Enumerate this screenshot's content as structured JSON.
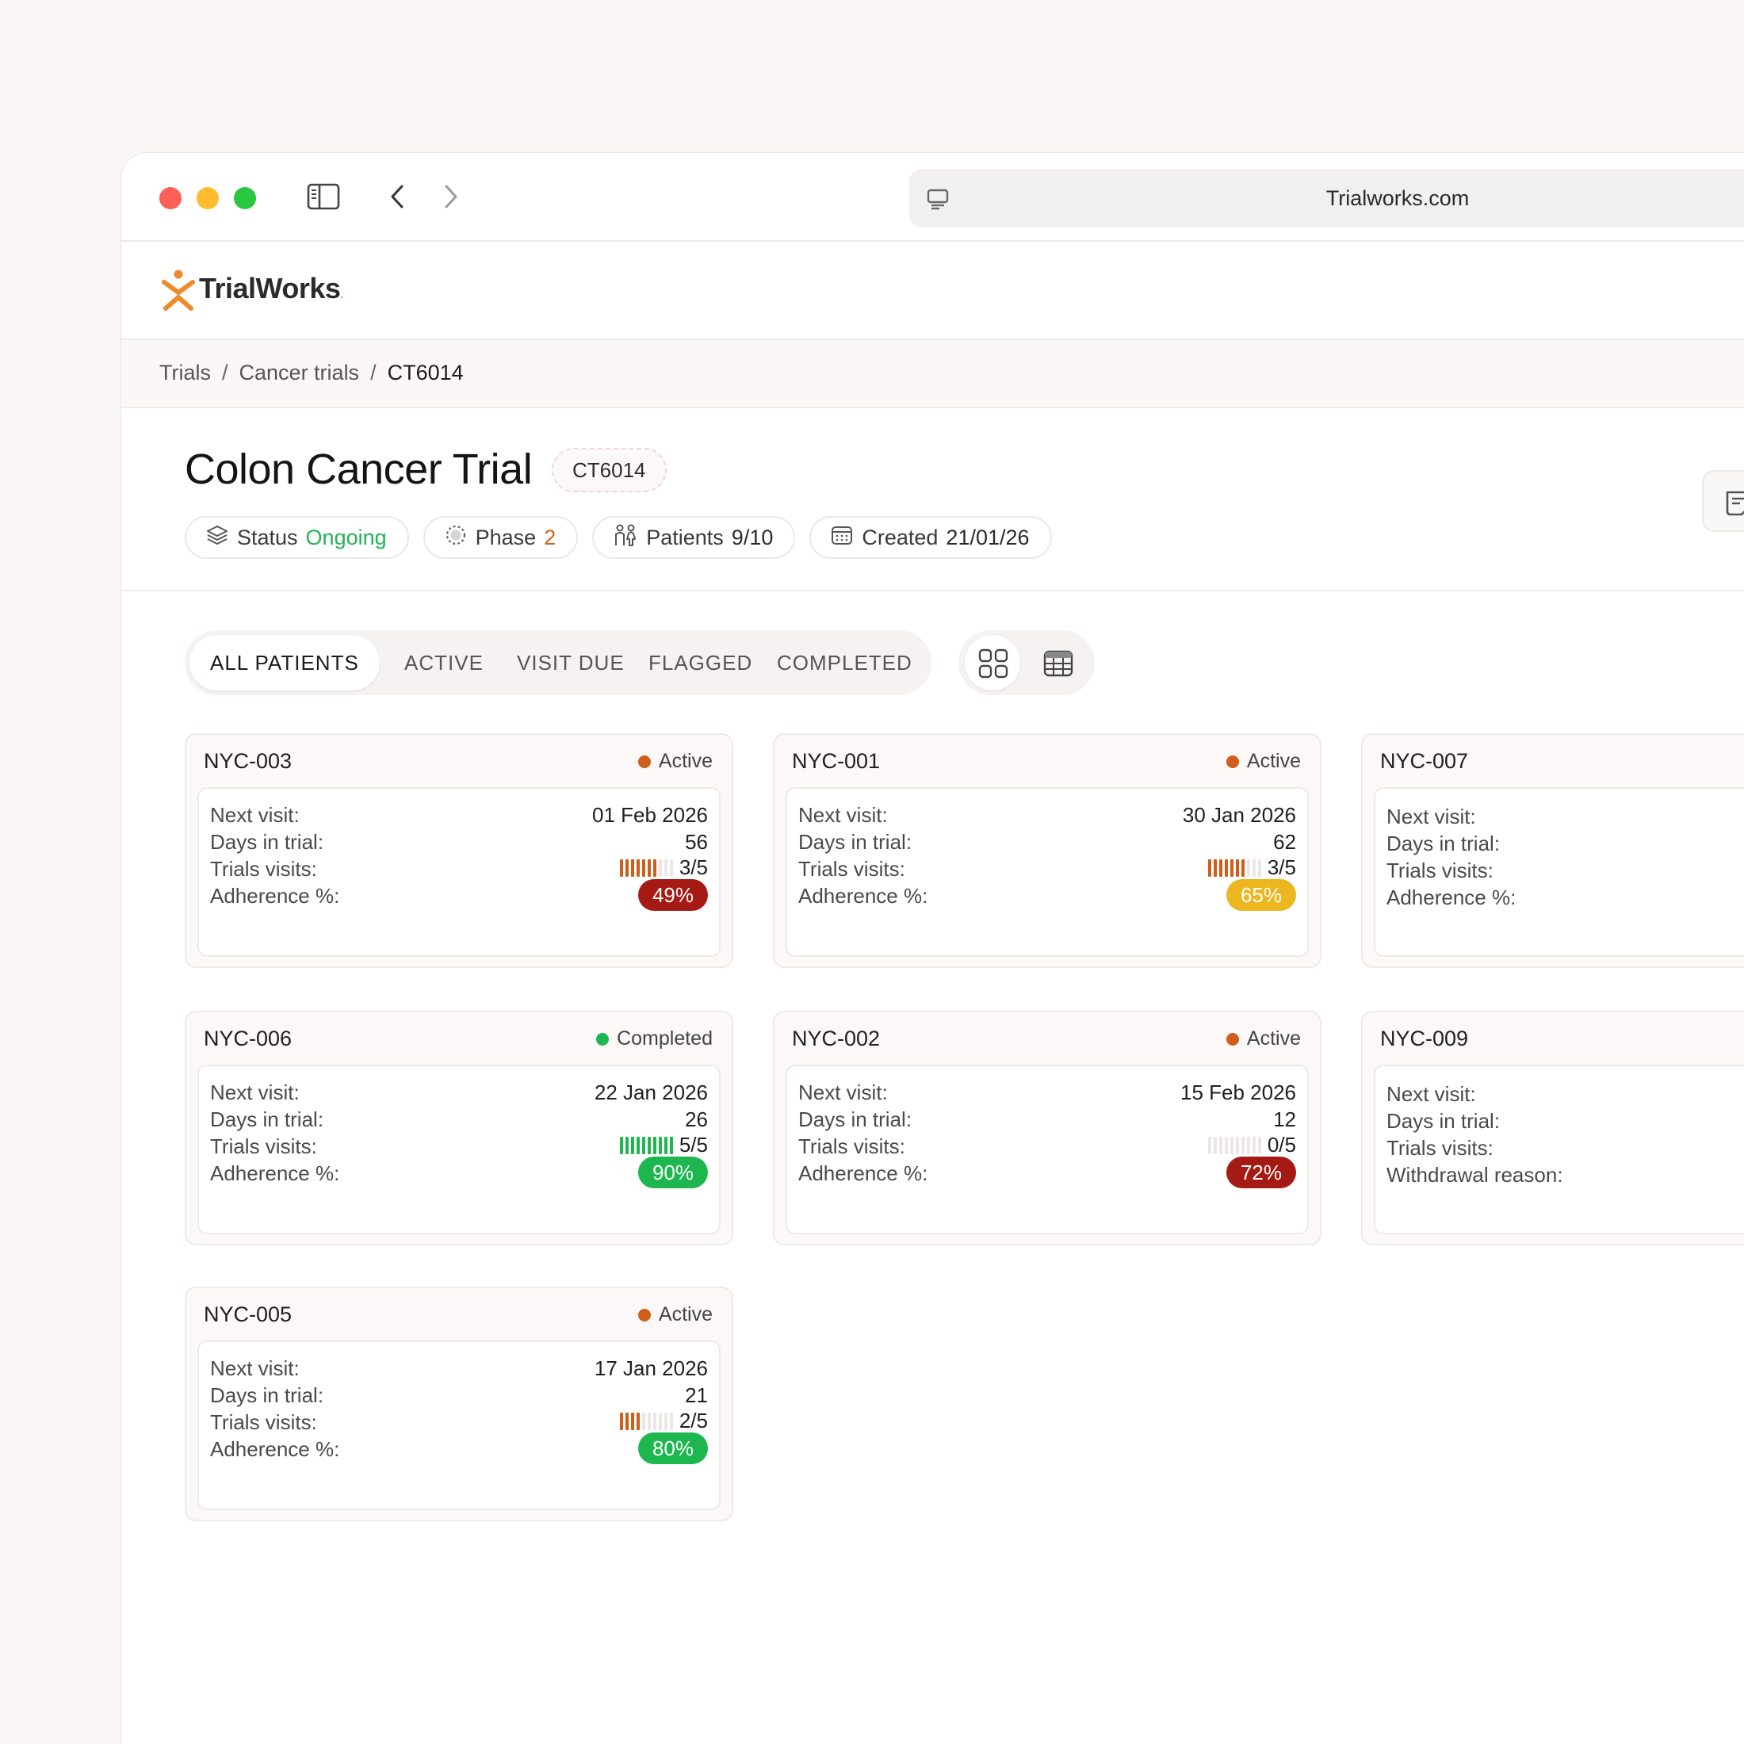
{
  "browser": {
    "url": "Trialworks.com"
  },
  "app": {
    "logo_text": "TrialWorks",
    "logo_mark_color": "#ee8a2c"
  },
  "breadcrumb": [
    "Trials",
    "Cancer trials",
    "CT6014"
  ],
  "trial": {
    "title": "Colon Cancer Trial",
    "code": "CT6014",
    "chips": [
      {
        "label": "Status",
        "value": "Ongoing",
        "icon": "layers-icon"
      },
      {
        "label": "Phase",
        "value": "2",
        "icon": "dashed-circle-icon"
      },
      {
        "label": "Patients",
        "value": "9/10",
        "icon": "people-icon"
      },
      {
        "label": "Created",
        "value": "21/01/26",
        "icon": "calendar-icon"
      }
    ]
  },
  "tabs": [
    "ALL PATIENTS",
    "ACTIVE",
    "VISIT DUE",
    "FLAGGED",
    "COMPLETED"
  ],
  "active_tab": "ALL PATIENTS",
  "view_toggle": {
    "grid_icon": "grid-icon",
    "table_icon": "table-icon",
    "selected": "grid"
  },
  "colors": {
    "active": "#cf5e1b",
    "completed": "#1eb74f",
    "adherence_red": "#a51a14",
    "adherence_yellow": "#ecb71e",
    "adherence_green": "#1eb74f"
  },
  "labels": {
    "next_visit": "Next visit:",
    "days_in_trial": "Days in trial:",
    "trial_visits": "Trials visits:",
    "adherence": "Adherence %:",
    "withdrawal": "Withdrawal reason:"
  },
  "patients": [
    {
      "id": "NYC-003",
      "status": "Active",
      "next_visit": "01 Feb 2026",
      "days": "56",
      "visits_done": 3,
      "visits_total": 5,
      "visits": "3/5",
      "adherence": "49%",
      "adherence_level": "red"
    },
    {
      "id": "NYC-001",
      "status": "Active",
      "next_visit": "30 Jan 2026",
      "days": "62",
      "visits_done": 3,
      "visits_total": 5,
      "visits": "3/5",
      "adherence": "65%",
      "adherence_level": "yellow"
    },
    {
      "id": "NYC-007",
      "status": "",
      "next_visit": "",
      "days": "",
      "visits": "",
      "adherence": "",
      "partial": true
    },
    {
      "id": "NYC-006",
      "status": "Completed",
      "next_visit": "22 Jan 2026",
      "days": "26",
      "visits_done": 5,
      "visits_total": 5,
      "visits": "5/5",
      "adherence": "90%",
      "adherence_level": "green"
    },
    {
      "id": "NYC-002",
      "status": "Active",
      "next_visit": "15 Feb 2026",
      "days": "12",
      "visits_done": 0,
      "visits_total": 5,
      "visits": "0/5",
      "adherence": "72%",
      "adherence_level": "red"
    },
    {
      "id": "NYC-009",
      "status": "",
      "next_visit": "",
      "days": "",
      "visits": "",
      "withdrawal": "",
      "partial": true,
      "withdrawn": true
    },
    {
      "id": "NYC-005",
      "status": "Active",
      "next_visit": "17 Jan 2026",
      "days": "21",
      "visits_done": 2,
      "visits_total": 5,
      "visits": "2/5",
      "adherence": "80%",
      "adherence_level": "green"
    }
  ]
}
